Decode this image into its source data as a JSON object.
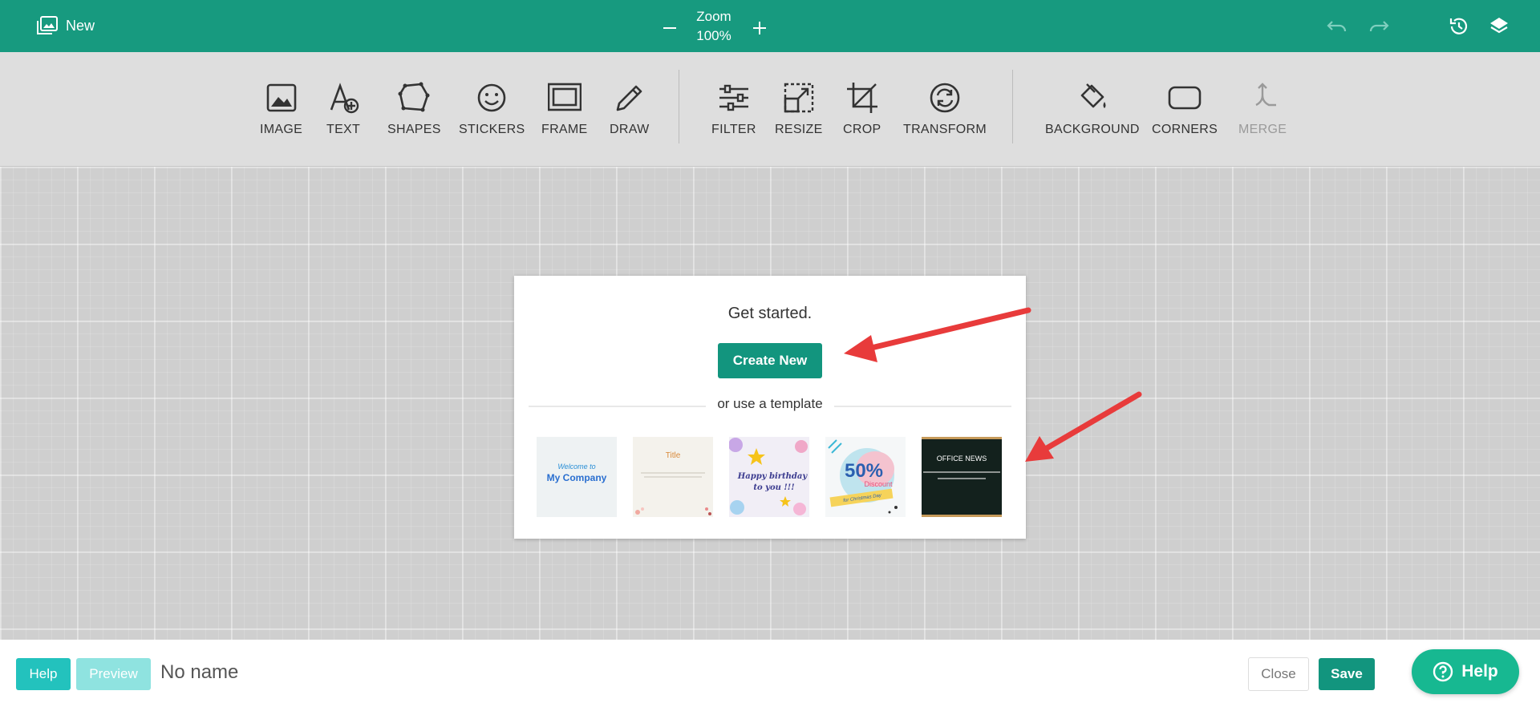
{
  "header": {
    "title": "New",
    "zoom_label": "Zoom",
    "zoom_value": "100%"
  },
  "toolbar": {
    "tools": [
      {
        "label": "IMAGE",
        "icon": "image-icon"
      },
      {
        "label": "TEXT",
        "icon": "text-add-icon"
      },
      {
        "label": "SHAPES",
        "icon": "shapes-icon"
      },
      {
        "label": "STICKERS",
        "icon": "smiley-icon"
      },
      {
        "label": "FRAME",
        "icon": "frame-icon"
      },
      {
        "label": "DRAW",
        "icon": "pencil-icon"
      },
      {
        "label": "FILTER",
        "icon": "sliders-icon"
      },
      {
        "label": "RESIZE",
        "icon": "resize-icon"
      },
      {
        "label": "CROP",
        "icon": "crop-icon"
      },
      {
        "label": "TRANSFORM",
        "icon": "transform-icon"
      },
      {
        "label": "BACKGROUND",
        "icon": "paint-bucket-icon"
      },
      {
        "label": "CORNERS",
        "icon": "rounded-corners-icon"
      },
      {
        "label": "MERGE",
        "icon": "merge-icon",
        "disabled": true
      }
    ]
  },
  "dialog": {
    "heading": "Get started.",
    "create_button": "Create New",
    "divider_text": "or use a template",
    "templates": [
      {
        "line1": "Welcome to",
        "line2": "My Company"
      },
      {
        "line1": "Title"
      },
      {
        "line1": "Happy birthday",
        "line2": "to you !!!"
      },
      {
        "line1": "50%",
        "line2": "Discount",
        "line3": "for Christmas Day"
      },
      {
        "line1": "OFFICE NEWS"
      }
    ]
  },
  "footer": {
    "help_label": "Help",
    "preview_label": "Preview",
    "doc_name": "No name",
    "close_label": "Close",
    "save_label": "Save",
    "floating_help_label": "Help"
  },
  "colors": {
    "brand": "#179a7f",
    "primary_button": "#12957e",
    "help_button": "#23c2bd",
    "annotation_arrow": "#e83b3b"
  }
}
